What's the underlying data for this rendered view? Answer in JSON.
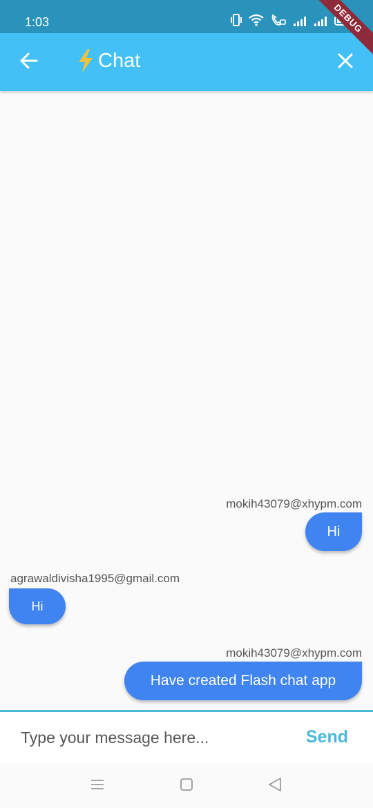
{
  "status_bar": {
    "time": "1:03",
    "icons": [
      "vibrate-icon",
      "wifi-icon",
      "wifi-call-icon",
      "signal-1-icon",
      "signal-2-icon",
      "battery-icon"
    ]
  },
  "debug_banner": "DEBUG",
  "app_bar": {
    "title": "Chat",
    "title_icon": "lightning-icon",
    "back_icon": "arrow-left-icon",
    "close_icon": "close-icon",
    "background": "#43c1f6",
    "bolt_color": "#f5c23e"
  },
  "messages": [
    {
      "sender": "mokih43079@xhypm.com",
      "text": "Hi",
      "is_me": true
    },
    {
      "sender": "agrawaldivisha1995@gmail.com",
      "text": "Hi",
      "is_me": false
    },
    {
      "sender": "mokih43079@xhypm.com",
      "text": "Have created Flash chat app",
      "is_me": true
    }
  ],
  "composer": {
    "placeholder": "Type your message here...",
    "value": "",
    "send_label": "Send",
    "accent": "#4ab8d8"
  },
  "bubble_color": "#3f84f0",
  "nav_bar": {
    "icons": [
      "menu-icon",
      "home-square-icon",
      "back-triangle-icon"
    ]
  }
}
